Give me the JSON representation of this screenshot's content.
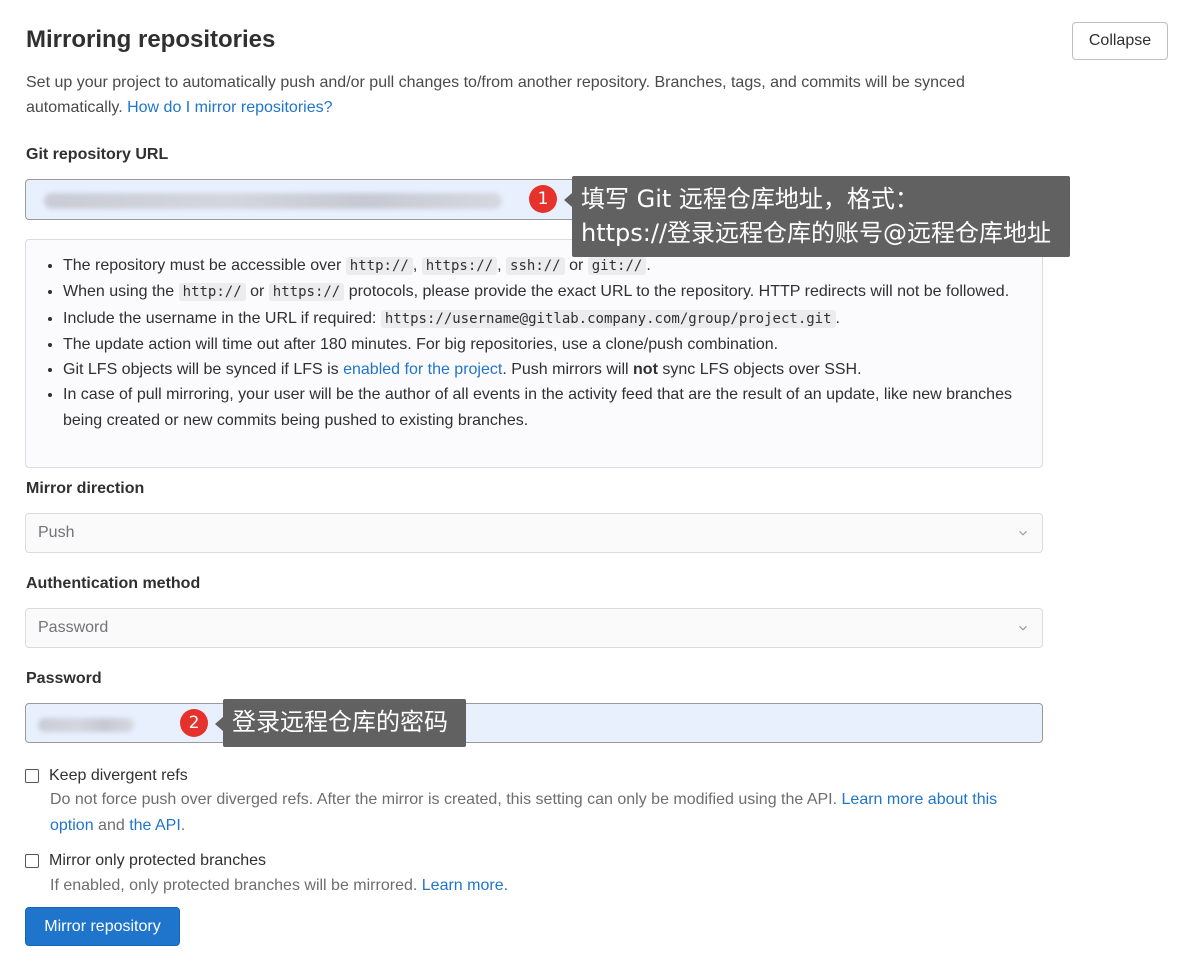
{
  "header": {
    "title": "Mirroring repositories",
    "collapse_label": "Collapse",
    "description": "Set up your project to automatically push and/or pull changes to/from another repository. Branches, tags, and commits will be synced automatically.",
    "description_link": "How do I mirror repositories?"
  },
  "url_field": {
    "label": "Git repository URL"
  },
  "help": {
    "item1_text": "The repository must be accessible over",
    "item1_codes": [
      "http://",
      "https://",
      "ssh://",
      "git://"
    ],
    "item1_or": "or",
    "item2_pre": "When using the",
    "item2_code1": "http://",
    "item2_or": "or",
    "item2_code2": "https://",
    "item2_post": "protocols, please provide the exact URL to the repository. HTTP redirects will not be followed.",
    "item3_pre": "Include the username in the URL if required:",
    "item3_code": "https://username@gitlab.company.com/group/project.git",
    "item4": "The update action will time out after 180 minutes. For big repositories, use a clone/push combination.",
    "item5_pre": "Git LFS objects will be synced if LFS is",
    "item5_link": "enabled for the project",
    "item5_mid": ". Push mirrors will",
    "item5_bold": "not",
    "item5_post": "sync LFS objects over SSH.",
    "item6": "In case of pull mirroring, your user will be the author of all events in the activity feed that are the result of an update, like new branches being created or new commits being pushed to existing branches."
  },
  "mirror_direction": {
    "label": "Mirror direction",
    "value": "Push"
  },
  "auth_method": {
    "label": "Authentication method",
    "value": "Password"
  },
  "password_field": {
    "label": "Password"
  },
  "keep_divergent": {
    "label": "Keep divergent refs",
    "help": "Do not force push over diverged refs. After the mirror is created, this setting can only be modified using the API.",
    "link1": "Learn more about this option",
    "and": "and",
    "link2": "the API",
    "checked": false
  },
  "protected_only": {
    "label": "Mirror only protected branches",
    "help": "If enabled, only protected branches will be mirrored.",
    "link": "Learn more.",
    "checked": false
  },
  "submit_label": "Mirror repository",
  "annotations": {
    "badge1": "1",
    "callout1_line1": "填写 Git 远程仓库地址，格式：",
    "callout1_line2": "https://登录远程仓库的账号@远程仓库地址",
    "badge2": "2",
    "callout2": "登录远程仓库的密码",
    "color_badge": "#e5322d",
    "color_callout": "#616161"
  },
  "colors": {
    "link": "#1f75cb",
    "primary_button": "#1f75cb",
    "autofill_bg": "#e8f0fe"
  },
  "icons": {
    "select_chevron": "chevron-down-icon",
    "checkbox": "checkbox-icon"
  }
}
